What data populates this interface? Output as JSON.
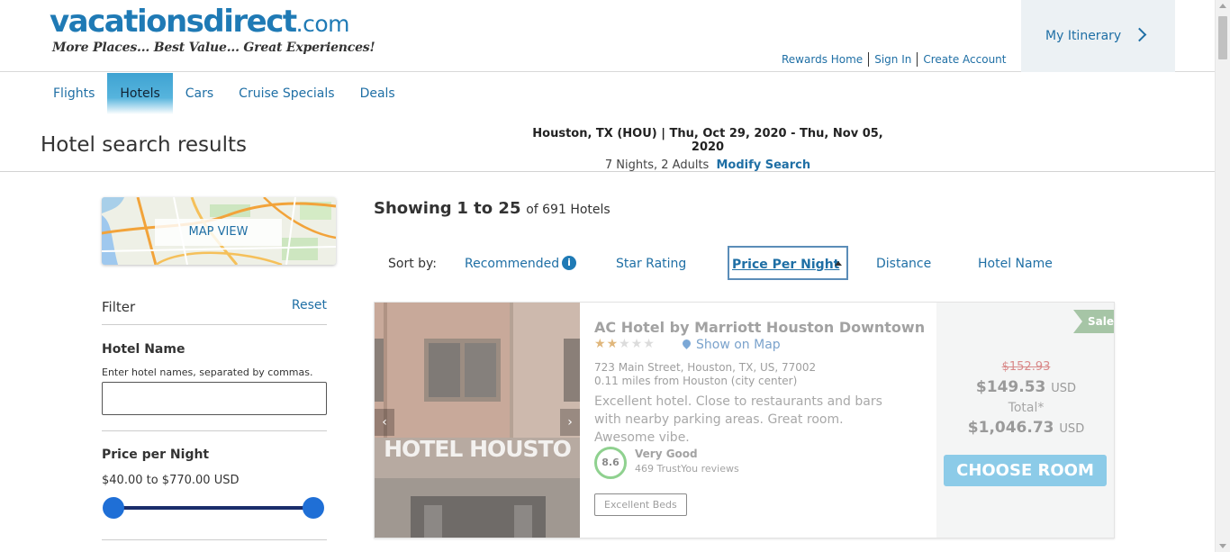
{
  "brand": {
    "logo_main": "vacationsdirect",
    "logo_tld": ".com",
    "tagline": "More Places... Best Value... Great Experiences!"
  },
  "toplinks": [
    "Rewards Home",
    "Sign In",
    "Create Account"
  ],
  "itinerary": {
    "label": "My Itinerary"
  },
  "nav": {
    "tabs": [
      "Flights",
      "Hotels",
      "Cars",
      "Cruise Specials",
      "Deals"
    ],
    "active": "Hotels"
  },
  "page": {
    "title": "Hotel search results"
  },
  "search": {
    "route": "Houston, TX (HOU) | Thu, Oct 29, 2020 - Thu, Nov 05, 2020",
    "summary": "7 Nights, 2 Adults",
    "modify_label": "Modify Search"
  },
  "sidebar": {
    "map_button": "MAP VIEW",
    "filter_title": "Filter",
    "reset_label": "Reset",
    "hotel_name": {
      "title": "Hotel Name",
      "hint": "Enter hotel names, separated by commas.",
      "value": "",
      "placeholder": ""
    },
    "price": {
      "title": "Price per Night",
      "range_text": "$40.00 to $770.00 USD",
      "min": 40,
      "max": 770,
      "selected_min": 40,
      "selected_max": 770
    }
  },
  "results": {
    "showing_prefix": "Showing",
    "showing_range": "1 to 25",
    "showing_suffix": "of 691 Hotels"
  },
  "sort": {
    "label": "Sort by:",
    "options": [
      "Recommended",
      "Star Rating",
      "Price Per Night",
      "Distance",
      "Hotel Name"
    ],
    "active": "Price Per Night",
    "info_glyph": "i"
  },
  "hotels": [
    {
      "name": "AC Hotel by Marriott Houston Downtown",
      "stars": 2,
      "max_stars": 5,
      "show_map_label": "Show on Map",
      "address": "723 Main Street,  Houston, TX, US, 77002",
      "distance": "0.11 miles from Houston (city center)",
      "description": "Excellent hotel. Close to restaurants and bars with nearby parking areas. Great room. Awesome vibe.",
      "score": "8.6",
      "score_label": "Very Good",
      "reviews": "469 TrustYou reviews",
      "amenity": "Excellent Beds",
      "photo_sign": "HOTEL HOUSTO",
      "badge": "Sale",
      "old_price": "$152.93",
      "price": "$149.53",
      "currency": "USD",
      "total_label": "Total*",
      "total": "$1,046.73",
      "cta": "CHOOSE ROOM"
    }
  ],
  "colors": {
    "link": "#1f6fa5",
    "brand": "#1f7ab5",
    "slider_knob": "#1f6fd6",
    "cta": "#8ccbe8",
    "sale": "#a6c5a6"
  },
  "icons": [
    "chevron-right-icon",
    "info-icon",
    "sort-caret-up-icon",
    "map-pin-icon",
    "arrow-left-icon",
    "arrow-right-icon"
  ]
}
